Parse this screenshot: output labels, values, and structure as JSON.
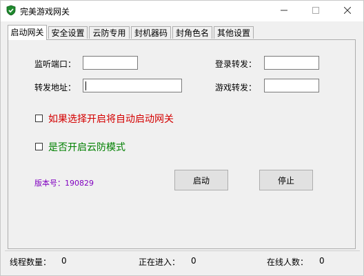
{
  "window": {
    "title": "完美游戏网关",
    "icon": "shield-check-icon",
    "controls": [
      "minimize-icon",
      "maximize-icon",
      "close-icon"
    ]
  },
  "tabs": [
    {
      "label": "启动网关",
      "active": true
    },
    {
      "label": "安全设置",
      "active": false
    },
    {
      "label": "云防专用",
      "active": false
    },
    {
      "label": "封机器码",
      "active": false
    },
    {
      "label": "封角色名",
      "active": false
    },
    {
      "label": "其他设置",
      "active": false
    }
  ],
  "form": {
    "listen_port_label": "监听端口：",
    "listen_port_value": "",
    "forward_addr_label": "转发地址：",
    "forward_addr_value": "",
    "login_forward_label": "登录转发：",
    "login_forward_value": "",
    "game_forward_label": "游戏转发：",
    "game_forward_value": ""
  },
  "options": {
    "auto_start_label": "如果选择开启将自动启动网关",
    "auto_start_checked": false,
    "auto_start_color": "#d40000",
    "cloud_mode_label": "是否开启云防模式",
    "cloud_mode_checked": false,
    "cloud_mode_color": "#008000"
  },
  "version": {
    "label": "版本号：190829",
    "color": "#8000c0"
  },
  "buttons": {
    "start": "启动",
    "stop": "停止"
  },
  "status": {
    "threads_label": "线程数量：",
    "threads_value": "0",
    "entering_label": "正在进入：",
    "entering_value": "0",
    "online_label": "在线人数：",
    "online_value": "0"
  }
}
